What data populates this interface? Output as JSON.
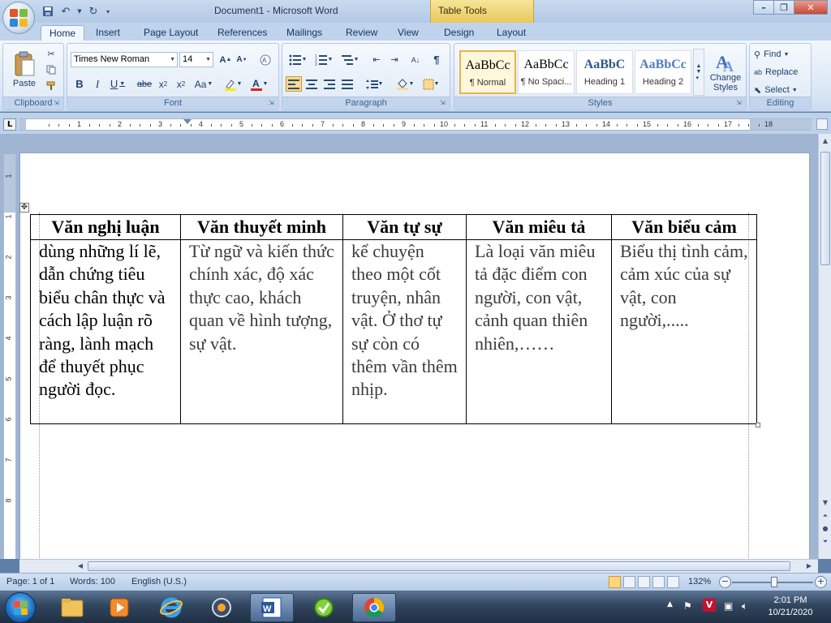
{
  "window": {
    "title": "Document1 - Microsoft Word",
    "contextual_tab_group": "Table Tools"
  },
  "tabs": [
    "Home",
    "Insert",
    "Page Layout",
    "References",
    "Mailings",
    "Review",
    "View",
    "Design",
    "Layout"
  ],
  "ribbon": {
    "clipboard": {
      "label": "Clipboard",
      "paste": "Paste"
    },
    "font": {
      "label": "Font",
      "font_name": "Times New Roman",
      "font_size": "14"
    },
    "paragraph": {
      "label": "Paragraph"
    },
    "styles": {
      "label": "Styles",
      "items": [
        {
          "sample": "AaBbCc",
          "name": "¶ Normal"
        },
        {
          "sample": "AaBbCc",
          "name": "¶ No Spaci..."
        },
        {
          "sample": "AaBbC",
          "name": "Heading 1"
        },
        {
          "sample": "AaBbCc",
          "name": "Heading 2"
        }
      ],
      "change_styles": "Change Styles"
    },
    "editing": {
      "label": "Editing",
      "find": "Find",
      "replace": "Replace",
      "select": "Select"
    }
  },
  "ruler": {
    "h_numbers": [
      "1",
      "2",
      "3",
      "4",
      "5",
      "6",
      "7",
      "8",
      "9",
      "10",
      "11",
      "12",
      "13",
      "14",
      "15",
      "16",
      "17",
      "18"
    ],
    "v_numbers": [
      "1",
      "1",
      "2",
      "3",
      "4",
      "5",
      "6",
      "7",
      "8"
    ]
  },
  "table": {
    "headers": [
      "Văn nghị luận",
      "Văn thuyết minh",
      "Văn tự sự",
      "Văn miêu tả",
      "Văn biểu cảm"
    ],
    "cells": [
      "dùng những lí lẽ, dẫn chứng tiêu biểu chân thực và cách lập luận rõ ràng, lành mạch để thuyết phục người đọc.",
      "Từ ngữ và kiến thức chính xác, độ xác thực cao, khách quan về hình tượng, sự vật.",
      "kể chuyện theo một cốt truyện, nhân vật. Ở thơ tự sự còn có thêm vần thêm nhịp.",
      "Là loại văn miêu tả đặc điểm con người, con vật, cảnh quan thiên nhiên,……",
      "Biểu thị tình cảm, cảm xúc của sự vật, con người,....."
    ]
  },
  "statusbar": {
    "page": "Page: 1 of 1",
    "words": "Words: 100",
    "language": "English (U.S.)",
    "zoom": "132%",
    "zoom_level": 0.5
  },
  "taskbar": {
    "time": "2:01 PM",
    "date": "10/21/2020"
  },
  "colors": {
    "office_blue": "#bfd3ed",
    "accent_gold": "#e8c95a",
    "close_red": "#c64a35"
  }
}
